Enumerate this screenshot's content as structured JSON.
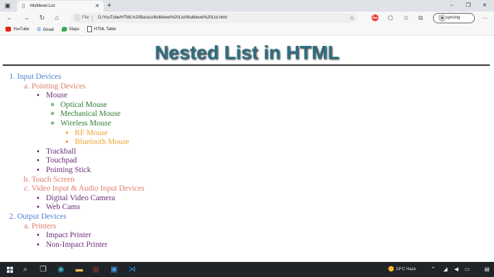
{
  "browser": {
    "tab_title": "Multilevel List",
    "new_tab_glyph": "+",
    "close_glyph": "✕",
    "window_controls": [
      "–",
      "❐",
      "✕"
    ],
    "address": {
      "prefix": "File",
      "path": "D:/YouTube/HTML%20Basics/Multilevel%20List/Multilevel%20List.html"
    },
    "sync_label": "Not syncing",
    "bookmarks": [
      "YouTube",
      "Gmail",
      "Maps",
      "HTML Table"
    ]
  },
  "page": {
    "heading": "Nested List in HTML",
    "heading_color": "#2f6f80",
    "list": [
      {
        "label": "Input Devices",
        "children": [
          {
            "label": "Pointing Devices",
            "children": [
              {
                "label": "Mouse",
                "children": [
                  {
                    "label": "Optical Mouse"
                  },
                  {
                    "label": "Mechanical Mouse"
                  },
                  {
                    "label": "Wireless Mouse",
                    "children": [
                      {
                        "label": "RF Mouse"
                      },
                      {
                        "label": "Bluetooth Mouse"
                      }
                    ]
                  }
                ]
              },
              {
                "label": "Trackball"
              },
              {
                "label": "Touchpad"
              },
              {
                "label": "Pointing Stick"
              }
            ]
          },
          {
            "label": "Touch Screen"
          },
          {
            "label": "Video Input & Audio Input Devices",
            "children": [
              {
                "label": "Digital Video Camera"
              },
              {
                "label": "Web Cams"
              }
            ]
          }
        ]
      },
      {
        "label": "Output Devices",
        "children": [
          {
            "label": "Printers",
            "children": [
              {
                "label": "Impact Printer"
              },
              {
                "label": "Non-Impact Printer"
              }
            ]
          }
        ]
      }
    ],
    "level_colors": [
      "#4a7fd0",
      "#e07b6a",
      "#6b2b7a",
      "#2e7d32",
      "#f0a030"
    ]
  },
  "taskbar": {
    "weather": "19°C  Haze",
    "icons": [
      "start-icon",
      "search-icon",
      "task-view-icon",
      "edge-icon",
      "file-explorer-icon",
      "chrome-icon",
      "slack-icon",
      "vscode-icon"
    ]
  }
}
